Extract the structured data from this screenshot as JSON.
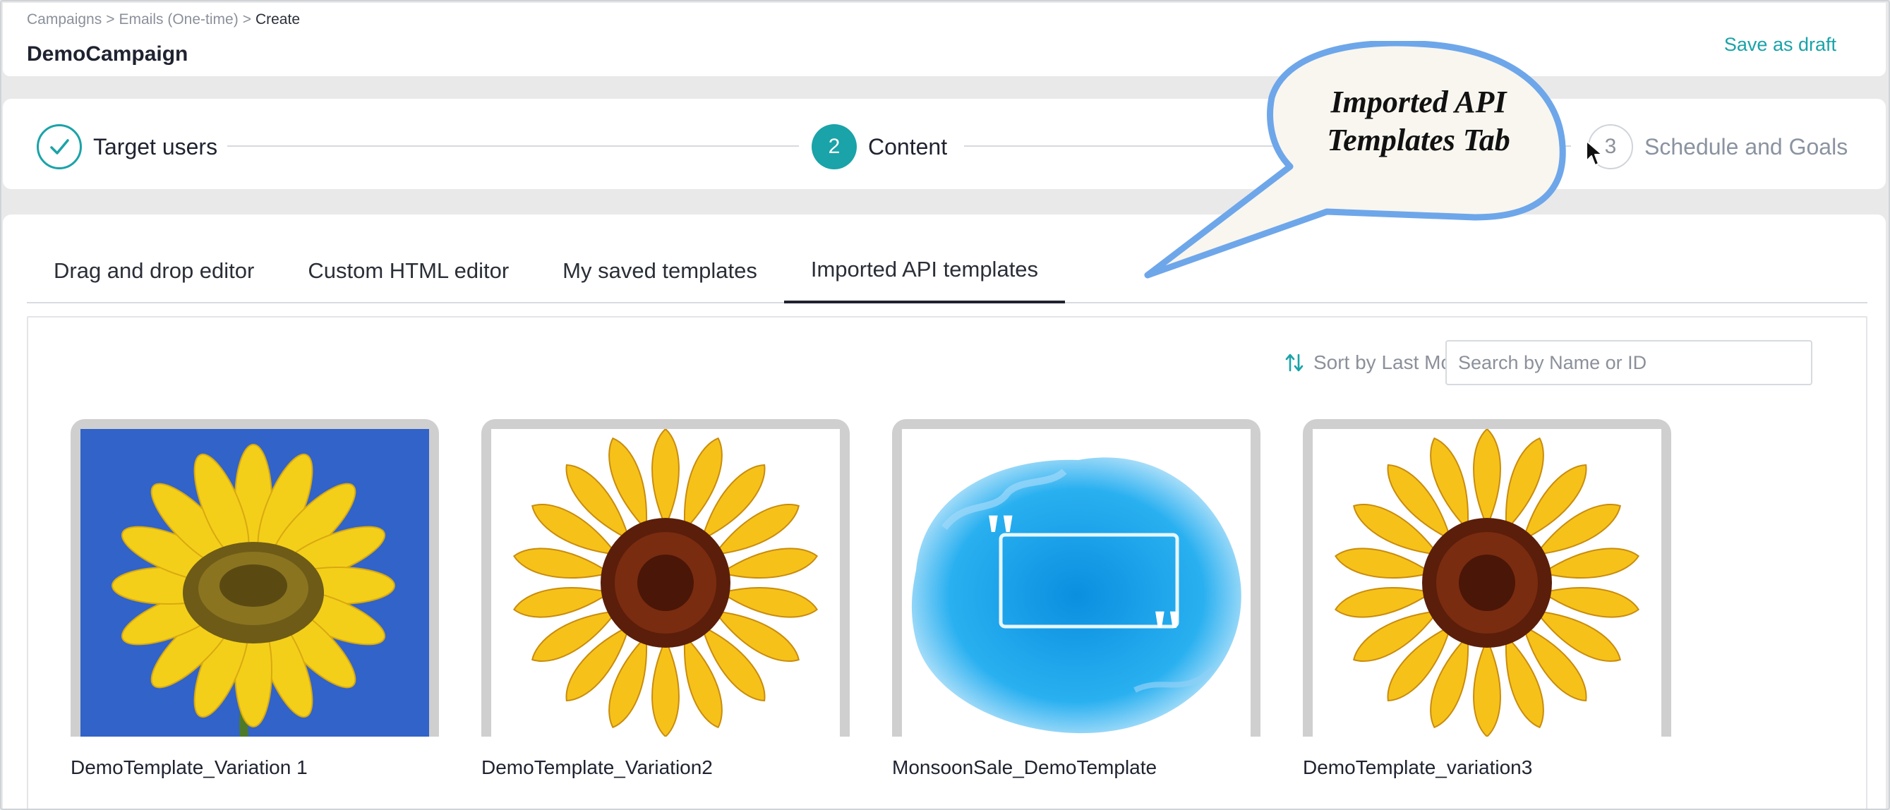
{
  "breadcrumb": [
    "Campaigns",
    "Emails (One-time)",
    "Create"
  ],
  "breadcrumb_separator": ">",
  "page_title": "DemoCampaign",
  "save_draft_label": "Save as draft",
  "steps": [
    {
      "number": "1",
      "label": "Target users",
      "state": "done"
    },
    {
      "number": "2",
      "label": "Content",
      "state": "active"
    },
    {
      "number": "3",
      "label": "Schedule and Goals",
      "state": "todo"
    }
  ],
  "tabs": [
    {
      "label": "Drag and drop editor",
      "active": false
    },
    {
      "label": "Custom HTML editor",
      "active": false
    },
    {
      "label": "My saved templates",
      "active": false
    },
    {
      "label": "Imported API templates",
      "active": true
    }
  ],
  "sort_label": "Sort by Last Modified",
  "search_placeholder": "Search by Name or ID",
  "templates": [
    {
      "name": "DemoTemplate_Variation 1",
      "image": "sunflower-photo"
    },
    {
      "name": "DemoTemplate_Variation2",
      "image": "sunflower-illustration"
    },
    {
      "name": "MonsoonSale_DemoTemplate",
      "image": "blue-quote-splash"
    },
    {
      "name": "DemoTemplate_variation3",
      "image": "sunflower-illustration"
    }
  ],
  "callout_text": [
    "Imported API",
    "Templates Tab"
  ],
  "colors": {
    "accent": "#1aa3a8",
    "callout_fill": "#f8f6ef",
    "callout_border": "#6ea6ea"
  }
}
